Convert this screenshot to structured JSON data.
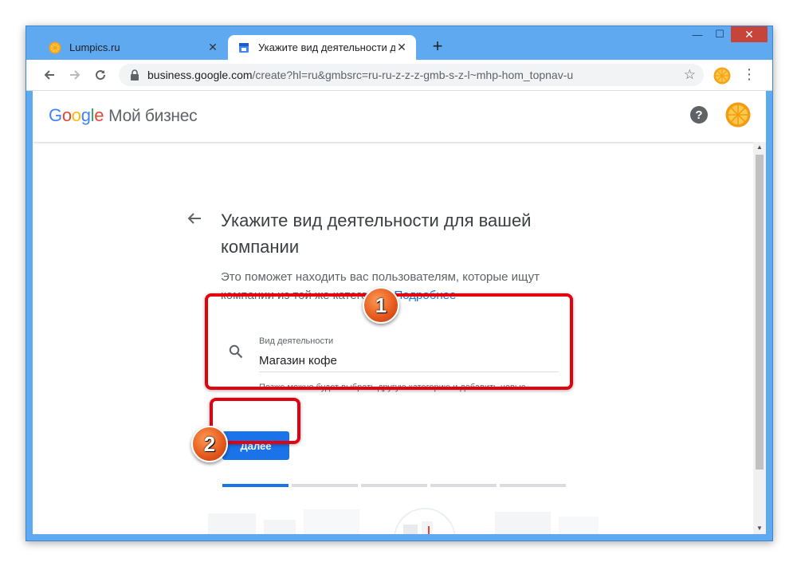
{
  "window": {
    "controls": [
      "—",
      "☐",
      "✕"
    ]
  },
  "tabs": [
    {
      "title": "Lumpics.ru",
      "active": false
    },
    {
      "title": "Укажите вид деятельности для ...",
      "active": true
    }
  ],
  "new_tab_label": "+",
  "omnibox": {
    "host": "business.google.com",
    "path": "/create?hl=ru&gmbsrc=ru-ru-z-z-z-gmb-s-z-l~mhp-hom_topnav-u"
  },
  "header": {
    "logo_letters": [
      "G",
      "o",
      "o",
      "g",
      "l",
      "e"
    ],
    "product_name": "Мой бизнес"
  },
  "page": {
    "title": "Укажите вид деятельности для вашей компании",
    "subtitle": "Это поможет находить вас пользователям, которые ищут компании из той же категории.",
    "learn_more": "Подробнее",
    "field_label": "Вид деятельности",
    "field_value": "Магазин кофе",
    "field_hint": "Позже можно будет выбрать другую категорию и добавить новые.",
    "next_button": "Далее",
    "progress_steps_total": 5,
    "progress_steps_done": 1
  },
  "annotations": {
    "badge_1": "1",
    "badge_2": "2"
  },
  "colors": {
    "window_frame": "#5ea9f0",
    "accent_blue": "#1a73e8",
    "callout_red": "#e3000f",
    "badge_orange": "#e4571b"
  }
}
